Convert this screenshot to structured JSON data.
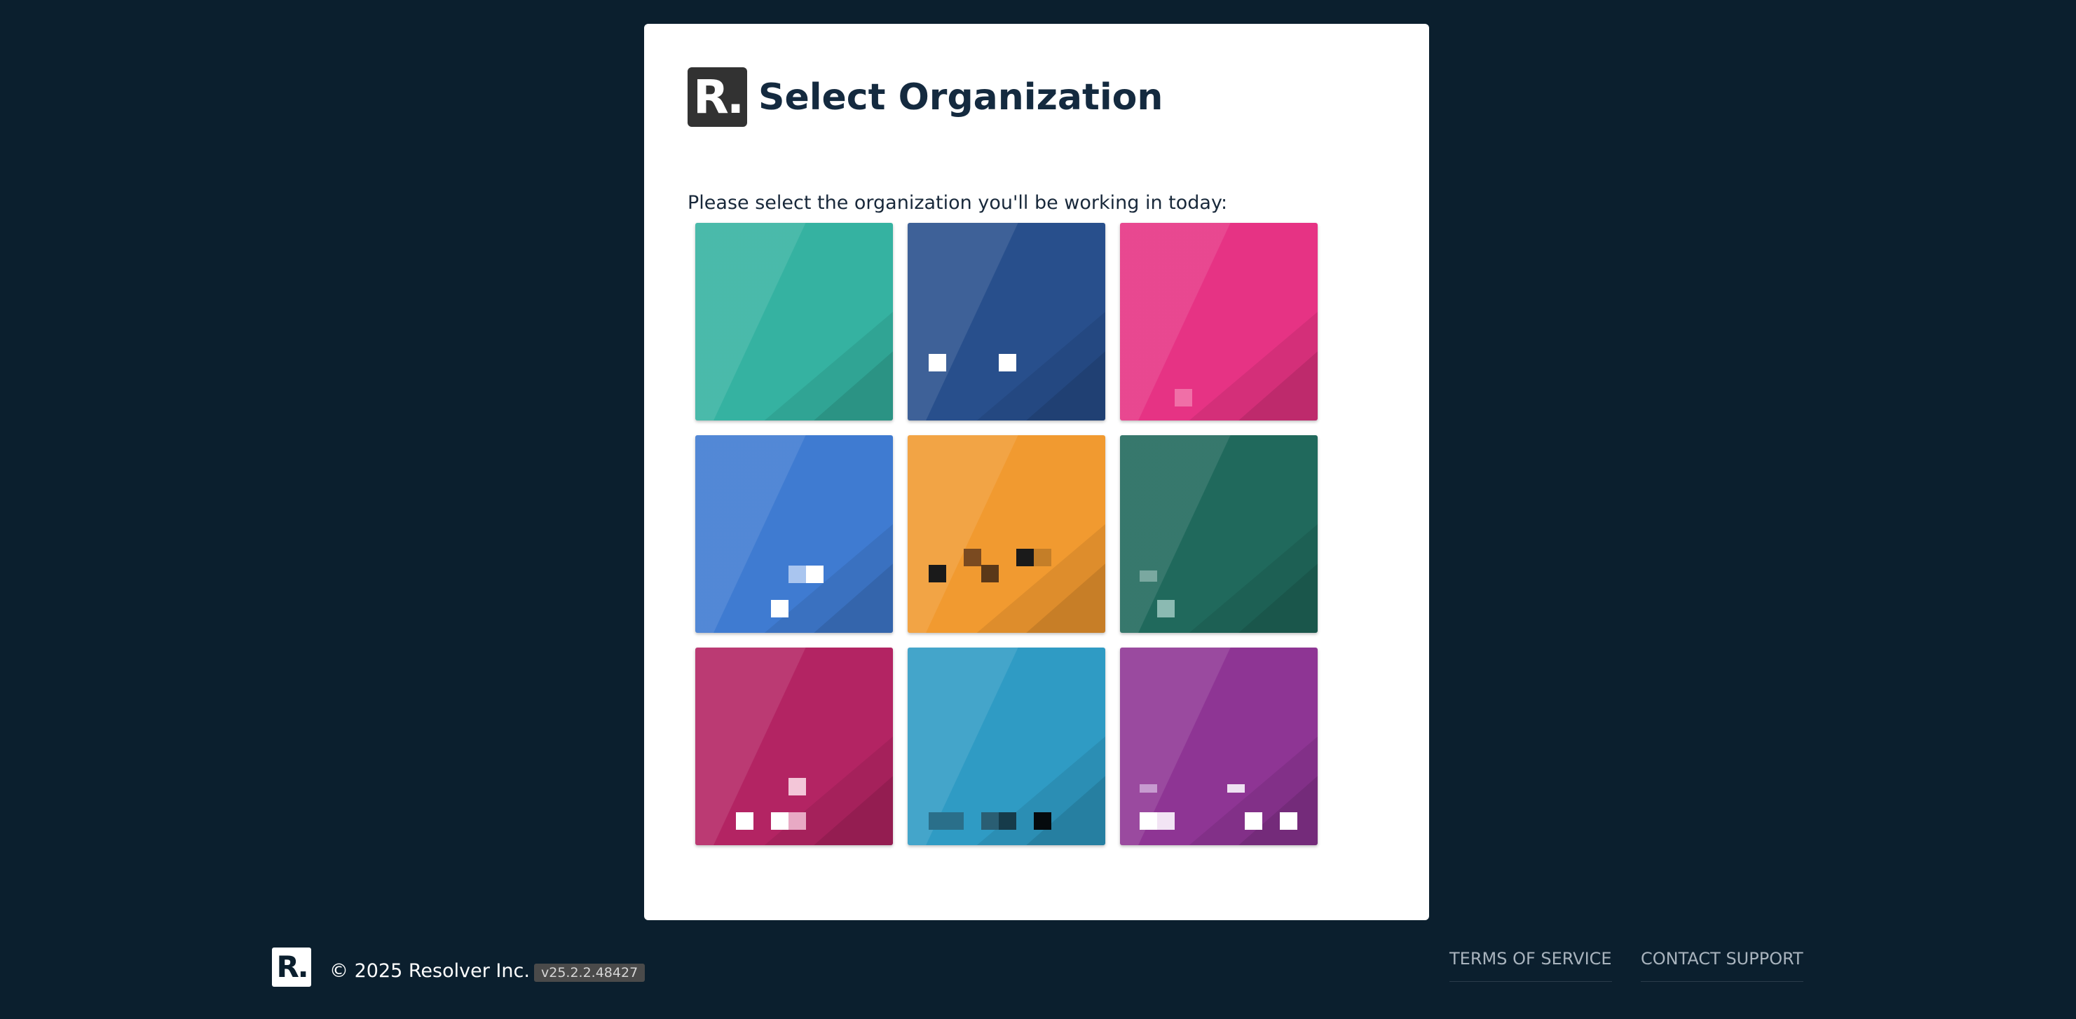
{
  "header": {
    "logo_text": "R.",
    "title": "Select Organization"
  },
  "subtitle": "Please select the organization you'll be working in today:",
  "organizations": [
    {
      "color": "#35b2a1"
    },
    {
      "color": "#284f8c"
    },
    {
      "color": "#e63384"
    },
    {
      "color": "#3f7bd1"
    },
    {
      "color": "#f19a30"
    },
    {
      "color": "#20695c"
    },
    {
      "color": "#b32463"
    },
    {
      "color": "#2f9bc4"
    },
    {
      "color": "#8e3594"
    }
  ],
  "footer": {
    "logo_text": "R.",
    "copyright": "© 2025 Resolver Inc.",
    "version": "v25.2.2.48427",
    "terms_label": "TERMS OF SERVICE",
    "support_label": "CONTACT SUPPORT"
  }
}
